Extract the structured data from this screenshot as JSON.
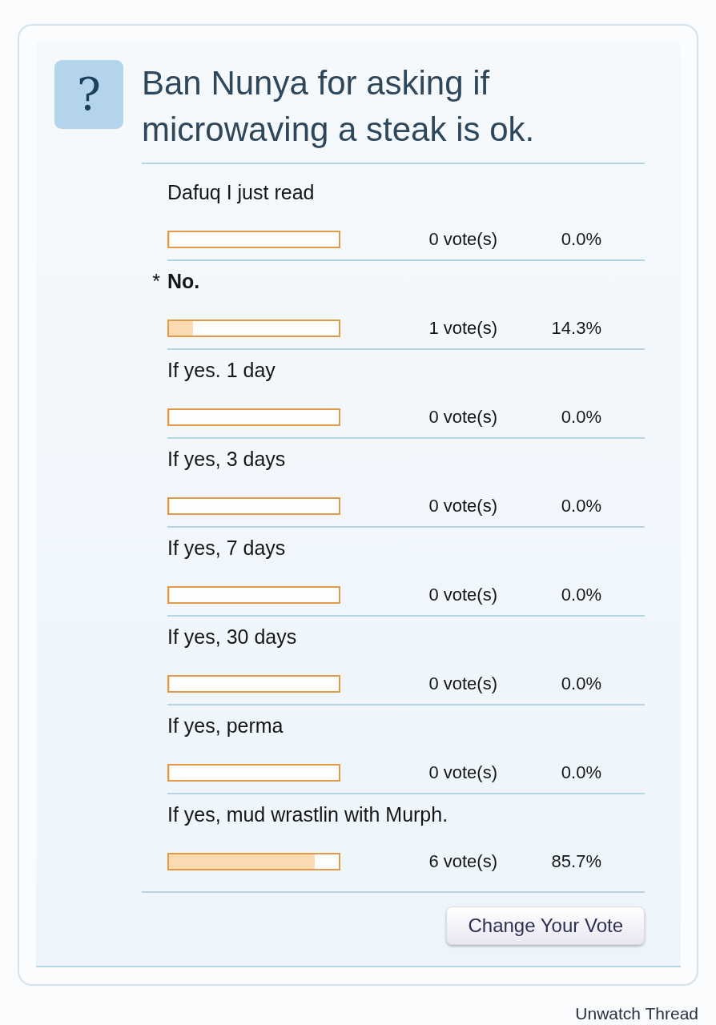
{
  "poll": {
    "icon": "?",
    "title": "Ban Nunya for asking if microwaving a steak is ok.",
    "vote_marker": "*",
    "options": [
      {
        "label": "Dafuq I just read",
        "selected": false,
        "level": 0,
        "votes": "0 vote(s)",
        "percent": "0.0%"
      },
      {
        "label": "No.",
        "selected": true,
        "level": 0.143,
        "votes": "1 vote(s)",
        "percent": "14.3%"
      },
      {
        "label": "If yes. 1 day",
        "selected": false,
        "level": 0,
        "votes": "0 vote(s)",
        "percent": "0.0%"
      },
      {
        "label": "If yes, 3 days",
        "selected": false,
        "level": 0,
        "votes": "0 vote(s)",
        "percent": "0.0%"
      },
      {
        "label": "If yes, 7 days",
        "selected": false,
        "level": 0,
        "votes": "0 vote(s)",
        "percent": "0.0%"
      },
      {
        "label": "If yes, 30 days",
        "selected": false,
        "level": 0,
        "votes": "0 vote(s)",
        "percent": "0.0%"
      },
      {
        "label": "If yes, perma",
        "selected": false,
        "level": 0,
        "votes": "0 vote(s)",
        "percent": "0.0%"
      },
      {
        "label": "If yes, mud wrastlin with Murph.",
        "selected": false,
        "level": 0.857,
        "votes": "6 vote(s)",
        "percent": "85.7%"
      }
    ],
    "change_vote_button": "Change Your Vote"
  },
  "unwatch_link": "Unwatch Thread"
}
